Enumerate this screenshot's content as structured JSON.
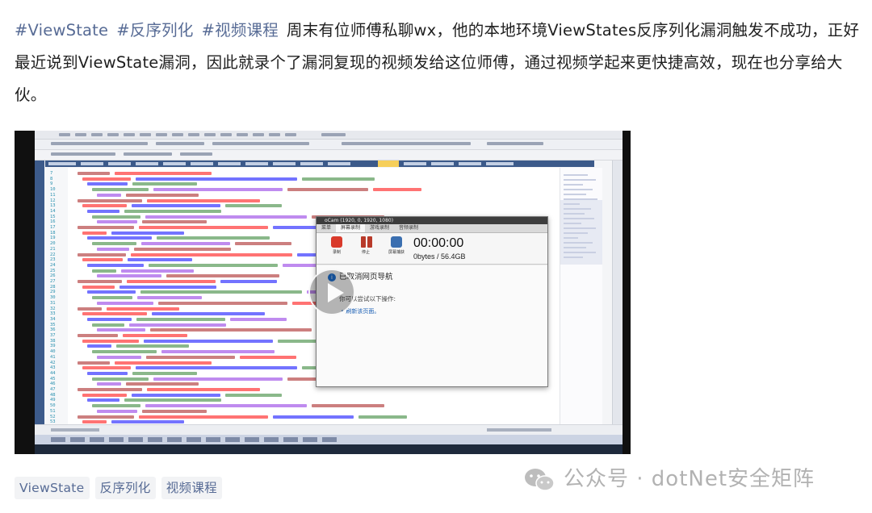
{
  "post": {
    "tags": [
      "#ViewState",
      "#反序列化",
      "#视频课程"
    ],
    "text": "周末有位师傅私聊wx，他的本地环境ViewStates反序列化漏洞触发不成功，正好最近说到ViewState漏洞，因此就录个了漏洞复现的视频发给这位师傅，通过视频学起来更快捷高效，现在也分享给大伙。"
  },
  "video": {
    "line_numbers": [
      "7",
      "8",
      "9",
      "10",
      "11",
      "12",
      "13",
      "14",
      "15",
      "16",
      "17",
      "18",
      "19",
      "20",
      "21",
      "22",
      "23",
      "24",
      "25",
      "26",
      "27",
      "28",
      "29",
      "30",
      "31",
      "32",
      "33",
      "34",
      "35",
      "36",
      "37",
      "38",
      "39",
      "40",
      "41",
      "42",
      "43",
      "44",
      "45",
      "46",
      "47",
      "48",
      "49",
      "50",
      "51",
      "52",
      "53"
    ],
    "recorder": {
      "title": "oCam (1920, 0, 1920, 1080)",
      "tabs": [
        "菜单",
        "屏幕录制",
        "游戏录制",
        "音频录制"
      ],
      "buttons": [
        "录制",
        "停止",
        "屏幕捕获"
      ],
      "timer": "00:00:00",
      "size": "0bytes / 56.4GB",
      "nav_cancelled": "已取消网页导航",
      "hint": "你可以尝试以下操作:",
      "link": "刷新该页面。"
    }
  },
  "bottom_tags": [
    "ViewState",
    "反序列化",
    "视频课程"
  ],
  "watermark": {
    "icon": "wechat-icon",
    "text": "公众号 · dotNet安全矩阵"
  },
  "colors": {
    "tag": "#576b95",
    "vs_blue": "#3c5a8a",
    "record_red": "#d93a2b"
  }
}
